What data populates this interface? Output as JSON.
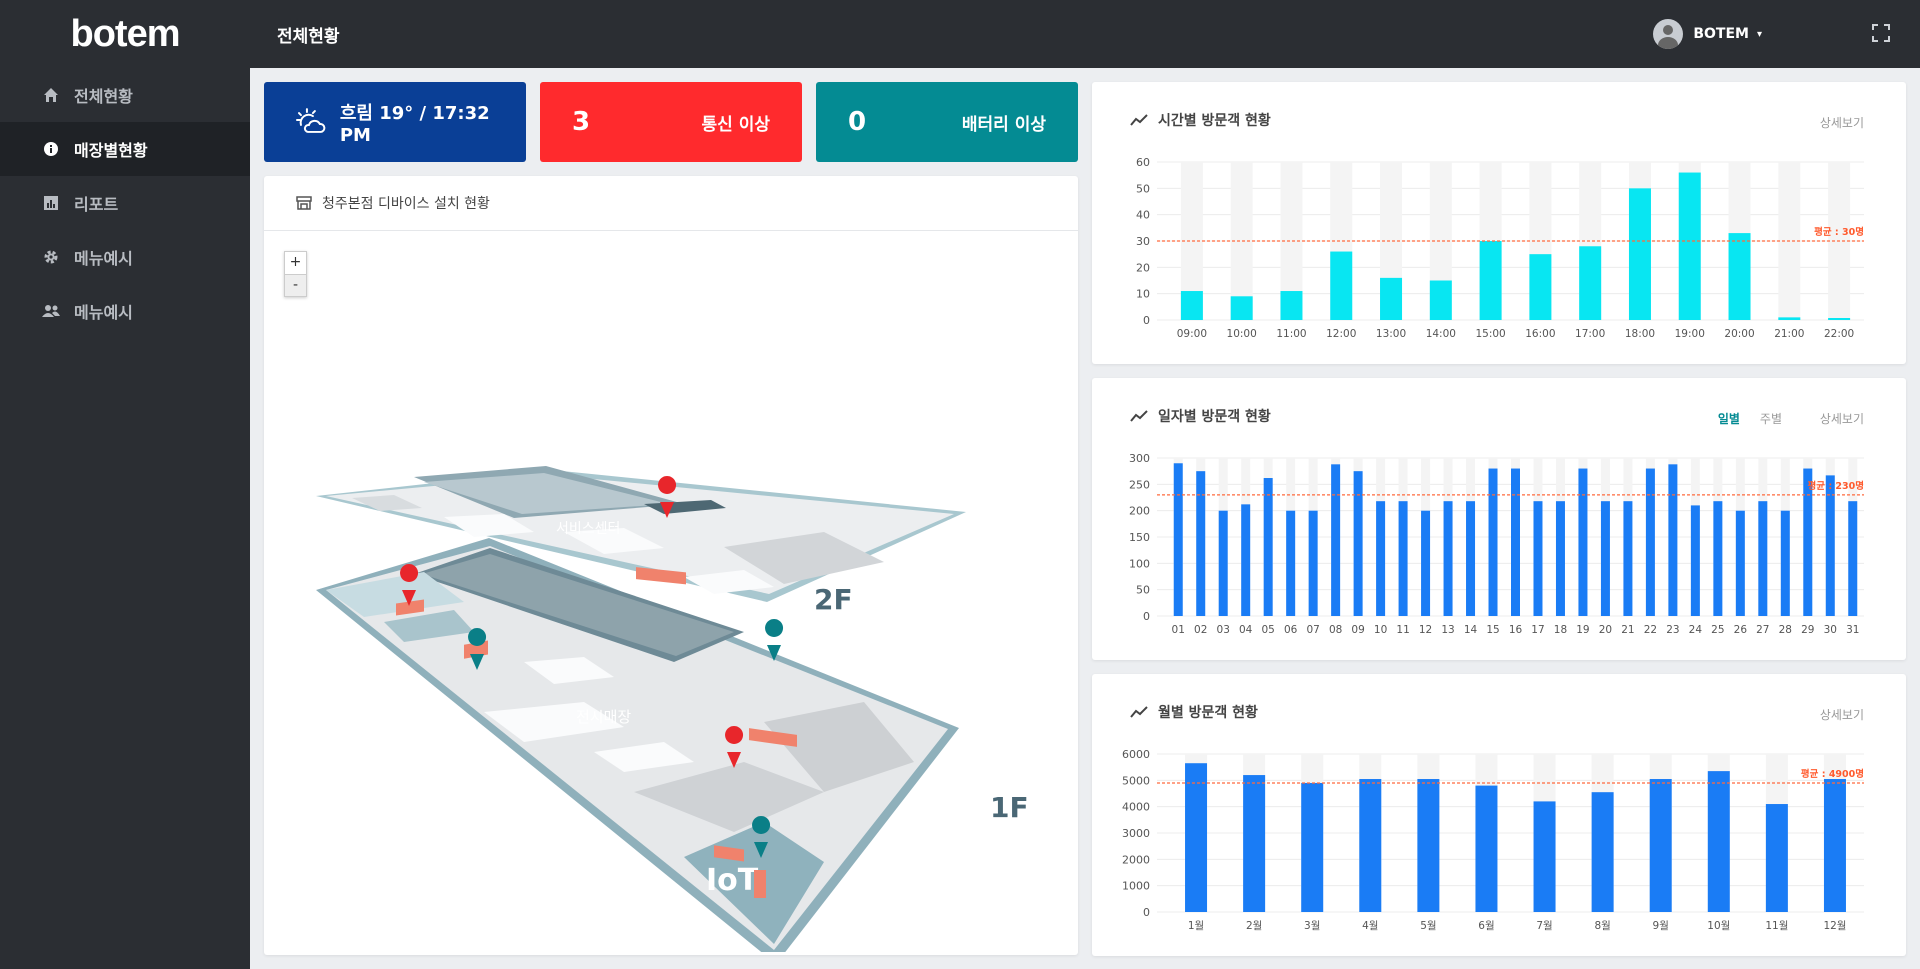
{
  "logo": "botem",
  "sidebar": {
    "items": [
      {
        "label": "전체현황",
        "icon": "home-icon"
      },
      {
        "label": "매장별현황",
        "icon": "info-icon"
      },
      {
        "label": "리포트",
        "icon": "chart-icon"
      },
      {
        "label": "메뉴예시",
        "icon": "gear-icon"
      },
      {
        "label": "메뉴예시",
        "icon": "users-icon"
      }
    ],
    "active_index": 1
  },
  "header": {
    "title": "전체현황",
    "user": "BOTEM"
  },
  "stats": {
    "weather": "흐림 19° / 17:32 PM",
    "comm_count": "3",
    "comm_label": "통신 이상",
    "battery_count": "0",
    "battery_label": "배터리 이상",
    "colors": {
      "weather": "#0a3f96",
      "comm": "#ff2a2d",
      "battery": "#048b93"
    }
  },
  "map": {
    "title": "청주본점 디바이스 설치 현황",
    "zoom_in": "+",
    "zoom_out": "-",
    "floor2": "2F",
    "floor1": "1F",
    "zone_service": "서비스센터",
    "zone_display": "전시매장",
    "zone_iot": "IoT"
  },
  "charts": {
    "more": "상세보기",
    "daily_tab": "일별",
    "weekly_tab": "주별"
  },
  "chart_data": [
    {
      "type": "bar",
      "title": "시간별 방문객 현황",
      "categories": [
        "09:00",
        "10:00",
        "11:00",
        "12:00",
        "13:00",
        "14:00",
        "15:00",
        "16:00",
        "17:00",
        "18:00",
        "19:00",
        "20:00",
        "21:00",
        "22:00"
      ],
      "values": [
        11,
        9,
        11,
        26,
        16,
        15,
        30,
        25,
        28,
        50,
        56,
        33,
        1,
        0
      ],
      "ylim": [
        0,
        60
      ],
      "yticks": [
        0,
        10,
        20,
        30,
        40,
        50,
        60
      ],
      "average": 30,
      "average_label": "평균 : 30명",
      "color": "#08e6f2"
    },
    {
      "type": "bar",
      "title": "일자별 방문객 현황",
      "categories": [
        "01",
        "02",
        "03",
        "04",
        "05",
        "06",
        "07",
        "08",
        "09",
        "10",
        "11",
        "12",
        "13",
        "14",
        "15",
        "16",
        "17",
        "18",
        "19",
        "20",
        "21",
        "22",
        "23",
        "24",
        "25",
        "26",
        "27",
        "28",
        "29",
        "30",
        "31"
      ],
      "values": [
        290,
        275,
        200,
        212,
        262,
        200,
        200,
        288,
        275,
        218,
        218,
        200,
        218,
        218,
        280,
        280,
        218,
        218,
        280,
        218,
        218,
        280,
        288,
        210,
        218,
        200,
        218,
        200,
        280,
        267,
        218
      ],
      "ylim": [
        0,
        300
      ],
      "yticks": [
        0,
        50,
        100,
        150,
        200,
        250,
        300
      ],
      "average": 230,
      "average_label": "평균 : 230명",
      "color": "#1a7cf5"
    },
    {
      "type": "bar",
      "title": "월별 방문객 현황",
      "categories": [
        "1월",
        "2월",
        "3월",
        "4월",
        "5월",
        "6월",
        "7월",
        "8월",
        "9월",
        "10월",
        "11월",
        "12월"
      ],
      "values": [
        5650,
        5200,
        4900,
        5050,
        5050,
        4800,
        4200,
        4550,
        5050,
        5350,
        4100,
        5050
      ],
      "ylim": [
        0,
        6000
      ],
      "yticks": [
        0,
        1000,
        2000,
        3000,
        4000,
        5000,
        6000
      ],
      "average": 4900,
      "average_label": "평균 : 4900명",
      "color": "#1a7cf5"
    }
  ]
}
